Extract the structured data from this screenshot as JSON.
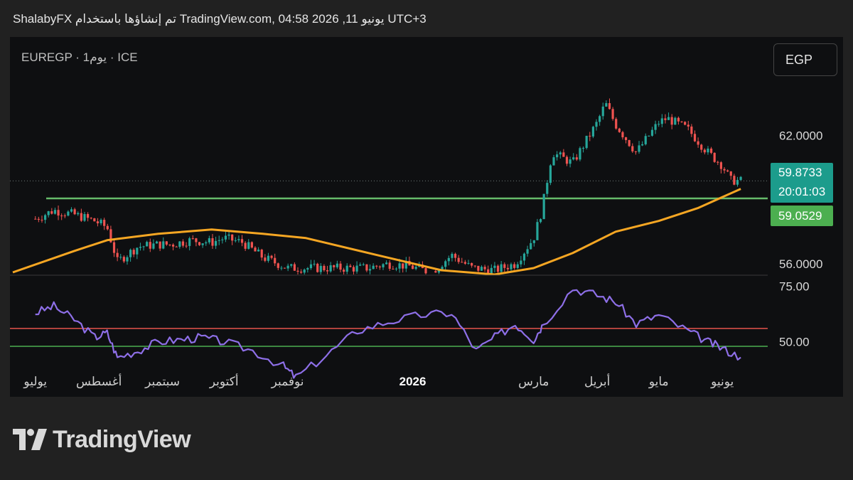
{
  "header": {
    "text": "ShalabyFX تم إنشاؤها باستخدام TradingView.com, 04:58 2026 ,11 يونيو UTC+3"
  },
  "symbol": {
    "text": "EUREGP · 1يوم · ICE"
  },
  "currency_button": "EGP",
  "price_labels": {
    "last_price": "59.8733",
    "countdown": "20:01:03",
    "level": "59.0529"
  },
  "logo_text": "TradingView",
  "colors": {
    "background": "#212121",
    "panel": "#0e0f11",
    "up": "#26a69a",
    "down": "#ef5350",
    "ma": "#f5a623",
    "level": "#66bb6a",
    "rsi": "#8e6fe8",
    "rsi_upper": "#e5534b",
    "rsi_lower": "#4caf50"
  },
  "chart_data": [
    {
      "type": "candlestick",
      "title": "",
      "x_ticks": [
        "يوليو",
        "أغسطس",
        "سبتمبر",
        "أكتوبر",
        "نوفمبر",
        "2026",
        "مارس",
        "أبريل",
        "مايو",
        "يونيو"
      ],
      "y_ticks": [
        "62.0000",
        "56.0000"
      ],
      "ylim": [
        55.5,
        65.0
      ],
      "horizontal_level": 59.0529,
      "last_price": 59.8733,
      "price_series": {
        "x": [
          "2025-07-01",
          "2025-07-10",
          "2025-07-20",
          "2025-07-30",
          "2025-08-05",
          "2025-08-10",
          "2025-08-20",
          "2025-08-30",
          "2025-09-05",
          "2025-09-15",
          "2025-09-25",
          "2025-10-01",
          "2025-10-10",
          "2025-10-20",
          "2025-11-01",
          "2025-12-10",
          "2025-12-20",
          "2025-12-30",
          "2026-01-10",
          "2026-01-20",
          "2026-01-30",
          "2026-02-10",
          "2026-02-20",
          "2026-03-01",
          "2026-03-05",
          "2026-03-10",
          "2026-03-20",
          "2026-04-01",
          "2026-04-05",
          "2026-04-10",
          "2026-04-20",
          "2026-05-01",
          "2026-05-05",
          "2026-05-15",
          "2026-05-25",
          "2026-06-01",
          "2026-06-05",
          "2026-06-10"
        ],
        "close": [
          58.1,
          58.5,
          58.3,
          58.0,
          57.7,
          56.1,
          56.8,
          56.9,
          56.9,
          57.1,
          57.0,
          57.2,
          57.0,
          56.3,
          55.8,
          55.8,
          56.0,
          55.9,
          55.6,
          56.4,
          55.8,
          55.7,
          56.0,
          57.2,
          58.5,
          61.2,
          60.7,
          62.6,
          63.5,
          62.5,
          61.2,
          62.6,
          62.8,
          62.3,
          61.2,
          60.6,
          59.9,
          59.87
        ]
      },
      "moving_average": {
        "x": [
          "2025-06-20",
          "2025-07-20",
          "2025-08-05",
          "2025-08-30",
          "2025-09-25",
          "2025-10-20",
          "2025-11-10",
          "2025-12-15",
          "2026-01-15",
          "2026-02-10",
          "2026-03-01",
          "2026-03-20",
          "2026-04-10",
          "2026-05-01",
          "2026-05-20",
          "2026-06-10"
        ],
        "values": [
          55.6,
          56.6,
          57.1,
          57.4,
          57.6,
          57.4,
          57.2,
          56.4,
          55.7,
          55.5,
          55.8,
          56.5,
          57.5,
          58.0,
          58.6,
          59.5
        ]
      }
    },
    {
      "type": "line",
      "title": "",
      "y_ticks": [
        "75.00",
        "50.00"
      ],
      "ylim": [
        40,
        78
      ],
      "upper_band": 56,
      "lower_band": 48,
      "x": [
        "2025-07-01",
        "2025-07-10",
        "2025-07-20",
        "2025-07-30",
        "2025-08-05",
        "2025-08-10",
        "2025-08-20",
        "2025-08-30",
        "2025-09-10",
        "2025-09-20",
        "2025-10-01",
        "2025-10-15",
        "2025-10-30",
        "2025-11-05",
        "2025-11-20",
        "2025-12-05",
        "2025-12-20",
        "2026-01-05",
        "2026-01-20",
        "2026-02-01",
        "2026-02-10",
        "2026-02-20",
        "2026-03-01",
        "2026-03-05",
        "2026-03-20",
        "2026-04-01",
        "2026-04-10",
        "2026-04-20",
        "2026-05-01",
        "2026-05-15",
        "2026-05-25",
        "2026-06-01",
        "2026-06-10"
      ],
      "values": [
        63,
        66,
        60,
        52,
        54,
        43,
        46,
        50,
        51,
        52,
        50,
        46,
        39,
        34,
        44,
        55,
        59,
        62,
        63,
        46,
        52,
        58,
        51,
        57,
        74,
        71,
        68,
        58,
        62,
        55,
        50,
        47,
        43
      ]
    }
  ]
}
